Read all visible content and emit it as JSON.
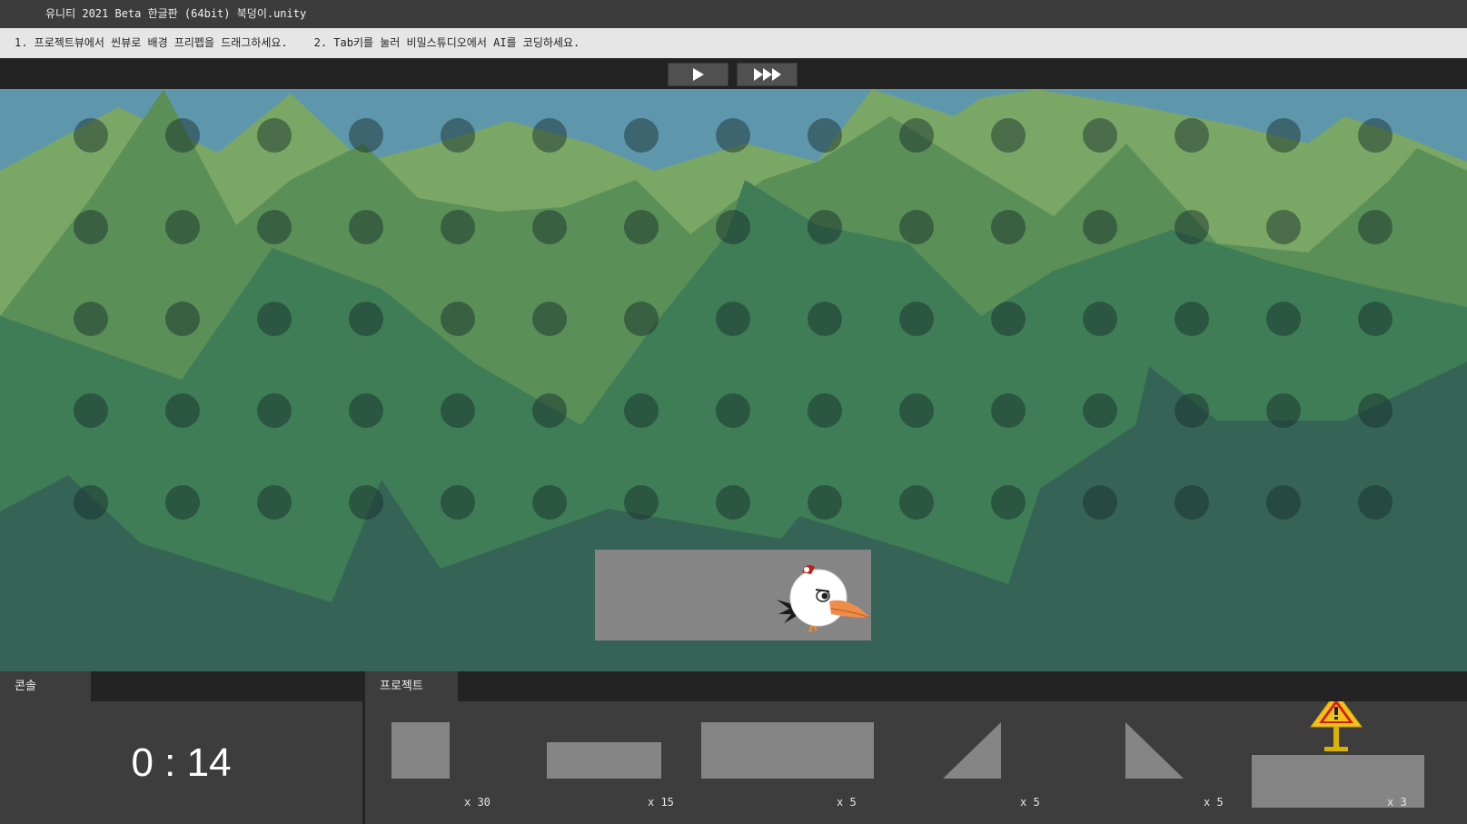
{
  "window": {
    "title": "유니티 2021 Beta 한글판 (64bit) 북덩이.unity"
  },
  "instructions": {
    "step1": "1. 프로젝트뷰에서 씬뷰로 배경 프리펩을 드래그하세요.",
    "step2": "2. Tab키를 눌러 비밀스튜디오에서 AI를 코딩하세요."
  },
  "toolbar": {
    "play_icon": "play-icon",
    "fast_forward_icon": "fast-forward-icon"
  },
  "scene": {
    "sky_color": "#5e97ac",
    "platform_color": "#858585",
    "character": "woodpecker-bird",
    "dot_grid": {
      "rows": 5,
      "columns": 15
    }
  },
  "console_panel": {
    "tab_label": "콘솔",
    "timer": "0 : 14"
  },
  "project_panel": {
    "tab_label": "프로젝트",
    "assets": [
      {
        "name": "square-block",
        "count": "x 30"
      },
      {
        "name": "small-plank",
        "count": "x 15"
      },
      {
        "name": "large-plank",
        "count": "x 5"
      },
      {
        "name": "ramp-left",
        "count": "x 5"
      },
      {
        "name": "ramp-right",
        "count": "x 5"
      },
      {
        "name": "warning-sign-platform",
        "count": "x 3",
        "icon": "warning-sign-icon"
      }
    ]
  }
}
